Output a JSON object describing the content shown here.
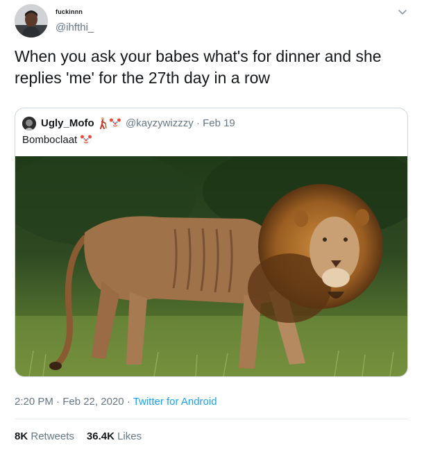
{
  "author": {
    "display_name": "fuckinnn",
    "handle": "@ihfthi_"
  },
  "tweet": {
    "text": "When you ask your babes what's for dinner and she replies 'me' for the 27th day in a row"
  },
  "quoted_tweet": {
    "author_name": "Ugly_Mofo",
    "handle_and_date": "@kayzywizzzy · Feb 19",
    "text": "Bomboclaat"
  },
  "meta": {
    "time_date": "2:20 PM · Feb 22, 2020 · ",
    "source": "Twitter for Android"
  },
  "stats": {
    "retweets_count": "8K",
    "retweets_label": "Retweets",
    "likes_count": "36.4K",
    "likes_label": "Likes"
  },
  "icons": {
    "menu": "chevron-down-icon",
    "emoji_person": "person-walking-with-cane-icon",
    "emoji_clown": "clown-face-icon"
  },
  "colors": {
    "link": "#1da1f2",
    "secondary_text": "#657786",
    "primary_text": "#14171a",
    "border": "#ccd6dd"
  }
}
